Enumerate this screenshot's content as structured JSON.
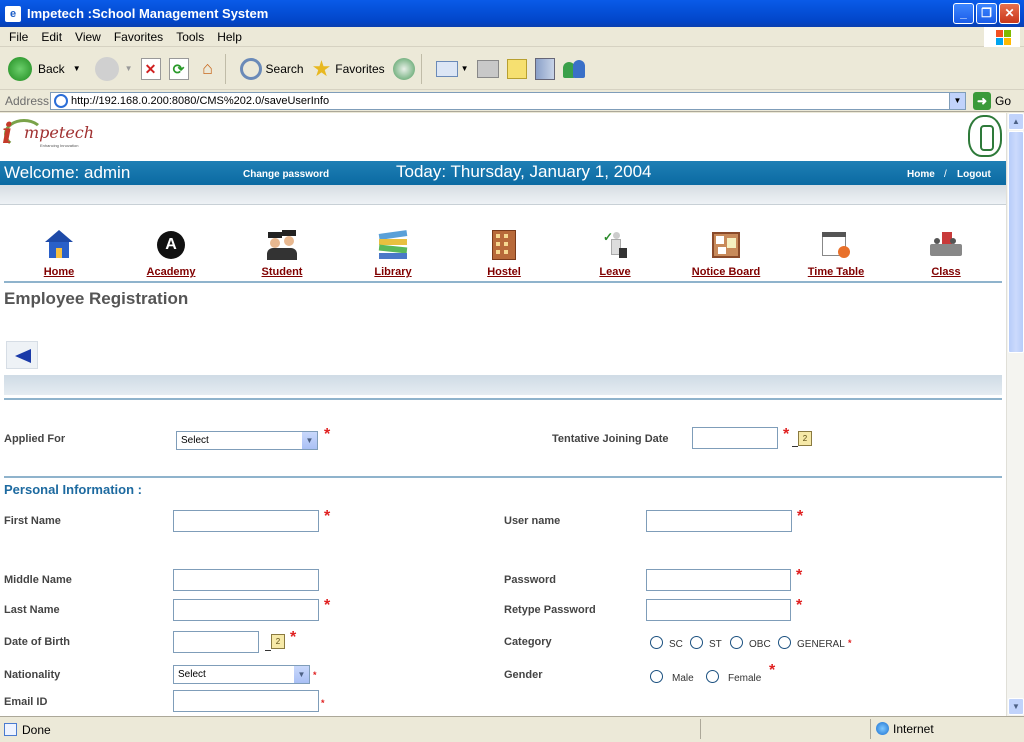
{
  "window": {
    "title": "Impetech :School Management System",
    "icon": "ie-page-icon"
  },
  "menu": [
    "File",
    "Edit",
    "View",
    "Favorites",
    "Tools",
    "Help"
  ],
  "toolbar": {
    "back": "Back",
    "search": "Search",
    "favorites": "Favorites"
  },
  "address": {
    "label": "Address",
    "url": "http://192.168.0.200:8080/CMS%202.0/saveUserInfo",
    "go": "Go"
  },
  "header": {
    "welcome": "Welcome: admin",
    "change_password": "Change password",
    "today": "Today: Thursday, January 1, 2004",
    "home": "Home",
    "separator": "/",
    "logout": "Logout"
  },
  "nav": [
    {
      "label": "Home",
      "icon": "home-icon"
    },
    {
      "label": "Academy",
      "icon": "academy-icon"
    },
    {
      "label": "Student",
      "icon": "student-icon"
    },
    {
      "label": "Library",
      "icon": "library-icon"
    },
    {
      "label": "Hostel",
      "icon": "hostel-icon"
    },
    {
      "label": "Leave",
      "icon": "leave-icon"
    },
    {
      "label": "Notice Board",
      "icon": "notice-board-icon"
    },
    {
      "label": "Time Table",
      "icon": "time-table-icon"
    },
    {
      "label": "Class",
      "icon": "class-icon"
    }
  ],
  "page": {
    "title": "Employee Registration"
  },
  "form": {
    "applied_for": {
      "label": "Applied For",
      "value": "Select"
    },
    "joining_date": {
      "label": "Tentative Joining Date",
      "value": ""
    },
    "section": "Personal Information :",
    "first_name": "First Name",
    "user_name": "User name",
    "middle_name": "Middle Name",
    "password": "Password",
    "last_name": "Last Name",
    "retype_password": "Retype Password",
    "dob": "Date of Birth",
    "category": {
      "label": "Category",
      "options": [
        "SC",
        "ST",
        "OBC",
        "GENERAL"
      ]
    },
    "nationality": {
      "label": "Nationality",
      "value": "Select"
    },
    "gender": {
      "label": "Gender",
      "options": [
        "Male",
        "Female"
      ]
    },
    "email": "Email ID",
    "required_mark": "*"
  },
  "status": {
    "text": "Done",
    "zone": "Internet"
  }
}
